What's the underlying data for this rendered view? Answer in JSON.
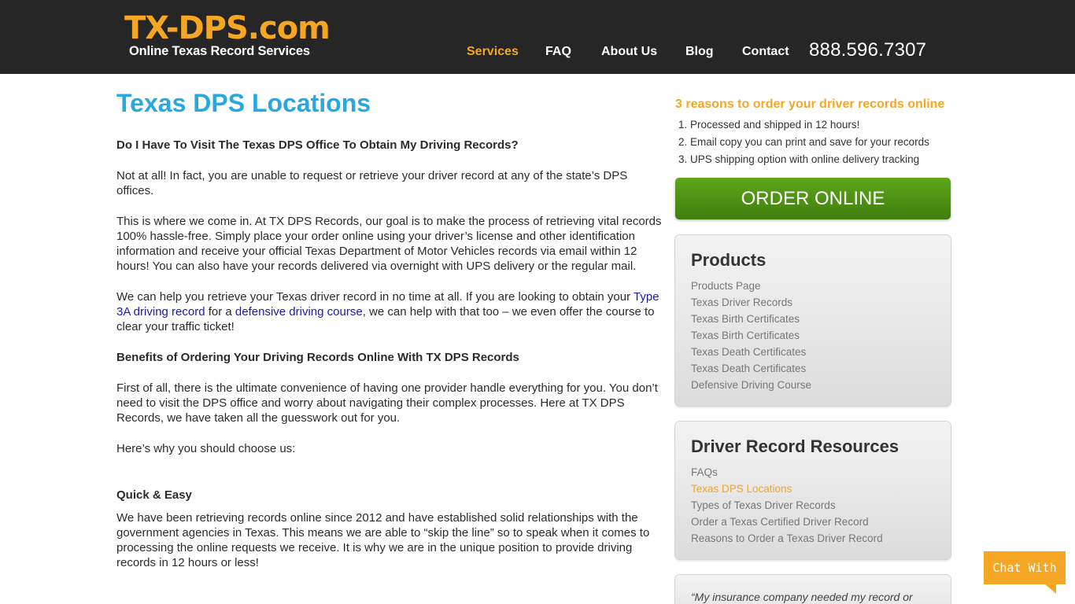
{
  "header": {
    "logo_main": "TX-DPS.com",
    "logo_sub": "Online Texas Record Services",
    "nav": [
      "Services",
      "FAQ",
      "About Us",
      "Blog",
      "Contact"
    ],
    "active_nav": "Services",
    "phone": "888.596.7307"
  },
  "main": {
    "title": "Texas DPS Locations",
    "q1": "Do I Have To Visit The Texas DPS Office To Obtain My Driving Records?",
    "p1": "Not at all! In fact, you are unable to request or retrieve your driver record at any of the state’s DPS offices.",
    "p2": "This is where we come in. At TX DPS Records, our goal is to make the process of retrieving vital records 100% hassle-free. Simply place your order online using your driver’s license and other identification information and receive your official Texas Department of Motor Vehicles records via email within 12 hours! You can also have your records delivered via overnight with UPS delivery or the regular mail.",
    "p3_a": "We can help you retrieve your Texas driver record in no time at all. If you are looking to obtain your ",
    "p3_link1": "Type 3A driving record",
    "p3_b": " for a ",
    "p3_link2": "defensive driving course",
    "p3_c": ", we can help with that too – we even offer the course to clear your traffic ticket!",
    "q2": "Benefits of Ordering Your Driving Records Online With TX DPS Records",
    "p4": "First of all, there is the ultimate convenience of having one provider handle everything for you. You don’t need to visit the DPS office and worry about navigating their complex processes. Here at TX DPS Records, we have taken all the guesswork out for you.",
    "p5": "Here’s why you should choose us:",
    "q3": "Quick & Easy",
    "p6": "We have been retrieving records online since 2012 and have established solid relationships with the government agencies in Texas. This means we are able to “skip the line” so to speak when it comes to processing the online requests we receive. It is why we are in the unique position to provide driving records in 12 hours or less!"
  },
  "sidebar": {
    "reasons_title": "3 reasons to order your driver records online",
    "reasons": [
      "1. Processed and shipped in 12 hours!",
      "2. Email copy you can print and save for your records",
      "3. UPS shipping option with online delivery tracking"
    ],
    "order_button": "ORDER ONLINE",
    "products": {
      "title": "Products",
      "links": [
        "Products Page",
        "Texas Driver Records",
        "Texas Birth Certificates",
        "Texas Birth Certificates",
        "Texas Death Certificates",
        "Texas Death Certificates",
        "Defensive Driving Course"
      ]
    },
    "resources": {
      "title": "Driver Record Resources",
      "links": [
        "FAQs",
        "Texas DPS Locations",
        "Types of Texas Driver Records",
        "Order a Texas Certified Driver Record",
        "Reasons to Order a Texas Driver Record"
      ],
      "active_link": "Texas DPS Locations"
    },
    "quote": "“My insurance company needed my record or"
  },
  "chat": {
    "label": "Chat With Us"
  },
  "colors": {
    "header_bg": "#262626",
    "accent_orange": "#f5a623",
    "title_blue": "#29a8e0",
    "button_green": "#4f9116",
    "link_blue": "#1a1aa6"
  }
}
